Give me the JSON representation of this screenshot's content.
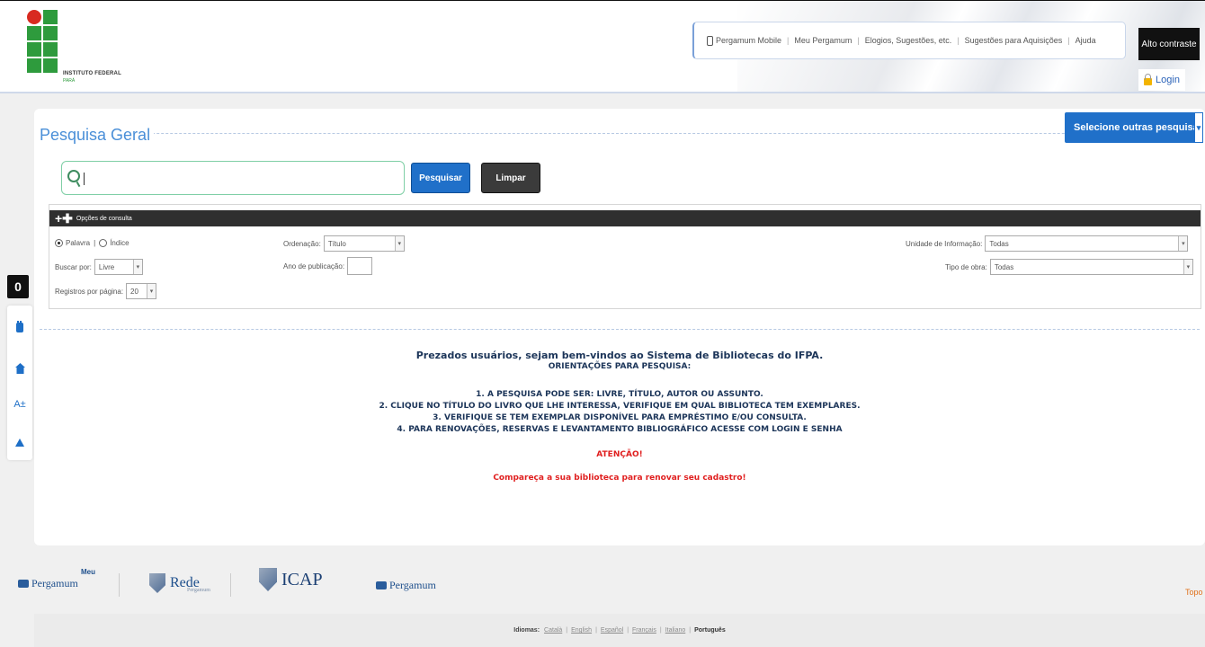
{
  "header": {
    "logo_text": "INSTITUTO FEDERAL",
    "logo_sub": "PARÁ",
    "nav": [
      "Pergamum Mobile",
      "Meu Pergamum",
      "Elogios, Sugestões, etc.",
      "Sugestões para Aquisições",
      "Ajuda"
    ],
    "contrast_label": "Alto contraste",
    "login_label": "Login"
  },
  "side_toolbar": {
    "zero_label": "0",
    "font_label": "A±"
  },
  "search": {
    "title": "Pesquisa Geral",
    "other_searches": "Selecione outras pesquisas",
    "input_value": "",
    "search_button": "Pesquisar",
    "clear_button": "Limpar"
  },
  "options": {
    "bar_label": "Opções de consulta",
    "radio_palavra": "Palavra",
    "radio_indice": "Índice",
    "ordenacao_label": "Ordenação:",
    "ordenacao_value": "Título",
    "unidade_label": "Unidade de Informação:",
    "unidade_value": "Todas",
    "buscar_label": "Buscar por:",
    "buscar_value": "Livre",
    "ano_label": "Ano de publicação:",
    "ano_value": "",
    "tipo_label": "Tipo de obra:",
    "tipo_value": "Todas",
    "registros_label": "Registros por página:",
    "registros_value": "20"
  },
  "welcome": {
    "title": "Prezados usuários, sejam bem-vindos ao Sistema de Bibliotecas do IFPA.",
    "subtitle": "ORIENTAÇÕES PARA PESQUISA:",
    "items": [
      "1. A PESQUISA PODE SER: LIVRE, TÍTULO, AUTOR OU ASSUNTO.",
      "2. CLIQUE NO TÍTULO DO LIVRO QUE LHE INTERESSA, VERIFIQUE EM QUAL BIBLIOTECA TEM EXEMPLARES.",
      "3. VERIFIQUE SE TEM EXEMPLAR DISPONÍVEL PARA EMPRÉSTIMO E/OU CONSULTA.",
      "4. PARA RENOVAÇÕES, RESERVAS E LEVANTAMENTO BIBLIOGRÁFICO ACESSE COM LOGIN E SENHA"
    ],
    "attention": "ATENÇÃO!",
    "notice": "Compareça a sua biblioteca para renovar seu cadastro!"
  },
  "footer": {
    "logo1_top": "Meu",
    "logo1": "Pergamum",
    "logo2": "Rede",
    "logo2_sub": "Pergamum",
    "logo3": "ICAP",
    "logo4": "Pergamum",
    "topo": "Topo",
    "languages_label": "Idiomas:",
    "languages": [
      "Català",
      "English",
      "Español",
      "Français",
      "Italiano"
    ],
    "current_language": "Português"
  }
}
